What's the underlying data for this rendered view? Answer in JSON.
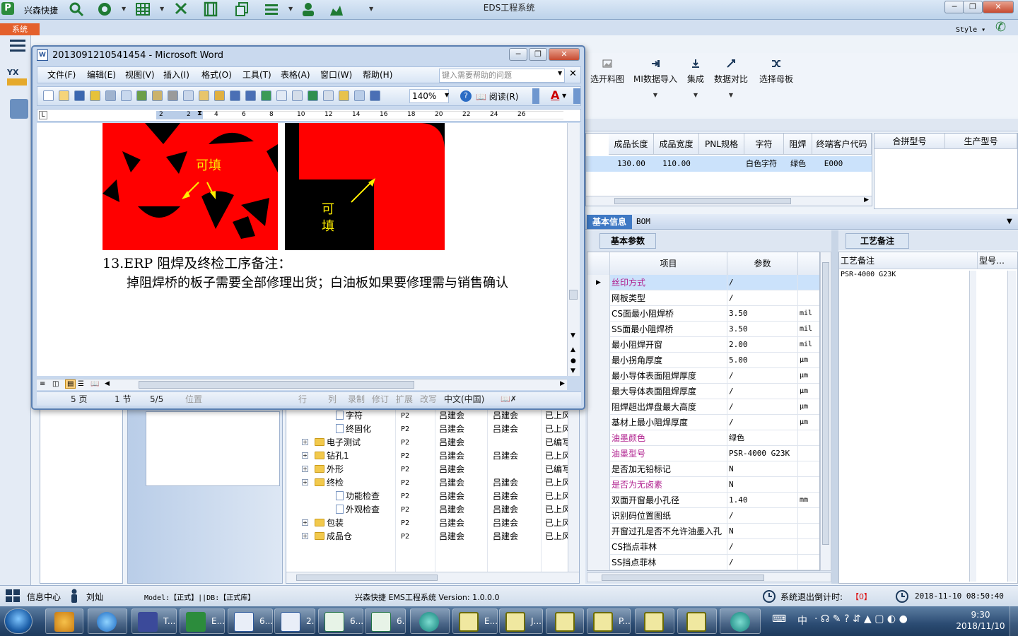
{
  "app": {
    "title": "EDS工程系统",
    "brand": "兴森快捷",
    "system_tab": "系统",
    "style_label": "Style"
  },
  "ribbon": {
    "buttons": [
      {
        "label": "选开料图"
      },
      {
        "label": "MI数据导入"
      },
      {
        "label": "集成"
      },
      {
        "label": "数据对比"
      },
      {
        "label": "选择母板"
      }
    ]
  },
  "product_grid": {
    "headers": [
      "成品长度",
      "成品宽度",
      "PNL规格",
      "字符",
      "阻焊",
      "终端客户代码"
    ],
    "row": [
      "130.00",
      "110.00",
      "",
      "白色字符",
      "绿色",
      "E000"
    ],
    "headers2": [
      "合拼型号",
      "生产型号"
    ]
  },
  "info": {
    "tabs": [
      "基本信息",
      "BOM"
    ],
    "subtab": "基本参数",
    "col_item": "项目",
    "col_param": "参数",
    "rows": [
      {
        "item": "丝印方式",
        "value": "/",
        "unit": "",
        "pink": true
      },
      {
        "item": "网板类型",
        "value": "/",
        "unit": "",
        "pink": false
      },
      {
        "item": "CS面最小阻焊桥",
        "value": "3.50",
        "unit": "mil",
        "pink": false
      },
      {
        "item": "SS面最小阻焊桥",
        "value": "3.50",
        "unit": "mil",
        "pink": false
      },
      {
        "item": "最小阻焊开窗",
        "value": "2.00",
        "unit": "mil",
        "pink": false
      },
      {
        "item": "最小拐角厚度",
        "value": "5.00",
        "unit": "μm",
        "pink": false
      },
      {
        "item": "最小导体表面阻焊厚度",
        "value": "/",
        "unit": "μm",
        "pink": false
      },
      {
        "item": "最大导体表面阻焊厚度",
        "value": "/",
        "unit": "μm",
        "pink": false
      },
      {
        "item": "阻焊超出焊盘最大高度",
        "value": "/",
        "unit": "μm",
        "pink": false
      },
      {
        "item": "基材上最小阻焊厚度",
        "value": "/",
        "unit": "μm",
        "pink": false
      },
      {
        "item": "油墨颜色",
        "value": "绿色",
        "unit": "",
        "pink": true
      },
      {
        "item": "油墨型号",
        "value": "PSR-4000 G23K",
        "unit": "",
        "pink": true
      },
      {
        "item": "是否加无铅标记",
        "value": "N",
        "unit": "",
        "pink": false
      },
      {
        "item": "是否为无卤素",
        "value": "N",
        "unit": "",
        "pink": true
      },
      {
        "item": "双面开窗最小孔径",
        "value": "1.40",
        "unit": "mm",
        "pink": false
      },
      {
        "item": "识别码位置图纸",
        "value": "/",
        "unit": "",
        "pink": false
      },
      {
        "item": "开窗过孔是否不允许油墨入孔",
        "value": "N",
        "unit": "",
        "pink": false
      },
      {
        "item": "CS挡点菲林",
        "value": "/",
        "unit": "",
        "pink": false
      },
      {
        "item": "SS挡点菲林",
        "value": "/",
        "unit": "",
        "pink": false
      }
    ]
  },
  "craft": {
    "tab": "工艺备注",
    "col1": "工艺备注",
    "col2": "型号…",
    "note": "PSR-4000 G23K"
  },
  "tree": {
    "rows": [
      {
        "name": "字符",
        "type": "doc",
        "indent": 1,
        "p": "P2",
        "a": "吕建会",
        "b": "吕建会",
        "s": "已上风"
      },
      {
        "name": "终固化",
        "type": "doc",
        "indent": 1,
        "p": "P2",
        "a": "吕建会",
        "b": "吕建会",
        "s": "已上风"
      },
      {
        "name": "电子测试",
        "type": "folder",
        "indent": 0,
        "p": "P2",
        "a": "吕建会",
        "b": "",
        "s": "已编写"
      },
      {
        "name": "钻孔1",
        "type": "folder",
        "indent": 0,
        "p": "P2",
        "a": "吕建会",
        "b": "吕建会",
        "s": "已上风"
      },
      {
        "name": "外形",
        "type": "folder",
        "indent": 0,
        "p": "P2",
        "a": "吕建会",
        "b": "",
        "s": "已编写"
      },
      {
        "name": "终检",
        "type": "folder",
        "indent": 0,
        "p": "P2",
        "a": "吕建会",
        "b": "吕建会",
        "s": "已上风"
      },
      {
        "name": "功能检查",
        "type": "doc",
        "indent": 1,
        "p": "P2",
        "a": "吕建会",
        "b": "吕建会",
        "s": "已上风"
      },
      {
        "name": "外观检查",
        "type": "doc",
        "indent": 1,
        "p": "P2",
        "a": "吕建会",
        "b": "吕建会",
        "s": "已上风"
      },
      {
        "name": "包装",
        "type": "folder",
        "indent": 0,
        "p": "P2",
        "a": "吕建会",
        "b": "吕建会",
        "s": "已上风"
      },
      {
        "name": "成品仓",
        "type": "folder",
        "indent": 0,
        "p": "P2",
        "a": "吕建会",
        "b": "吕建会",
        "s": "已上风"
      }
    ]
  },
  "word": {
    "title": "2013091210541454 - Microsoft Word",
    "menu": [
      "文件(F)",
      "编辑(E)",
      "视图(V)",
      "插入(I)",
      "格式(O)",
      "工具(T)",
      "表格(A)",
      "窗口(W)",
      "帮助(H)"
    ],
    "help_placeholder": "键入需要帮助的问题",
    "zoom": "140%",
    "read_btn": "阅读(R)",
    "img1_label": "可填",
    "img2_label": "可填",
    "heading": "13.ERP 阻焊及终检工序备注：",
    "body": "掉阻焊桥的板子需要全部修理出货；白油板如果要修理需与销售确认",
    "ruler_ticks": [
      "2",
      "2",
      "4",
      "6",
      "8",
      "10",
      "12",
      "14",
      "16",
      "18",
      "20",
      "22",
      "24",
      "26"
    ],
    "status": {
      "page": "5 页",
      "section": "1 节",
      "pages": "5/5",
      "position": "位置",
      "line": "行",
      "col": "列",
      "rec": "录制",
      "trk": "修订",
      "ext": "扩展",
      "ovr": "改写",
      "lang": "中文(中国)"
    }
  },
  "statusbar": {
    "info_center": "信息中心",
    "user": "刘灿",
    "model": "Model:【正式】||DB:【正式库】",
    "version": "兴森快捷 EMS工程系统 Version: 1.0.0.0",
    "countdown_label": "系统退出倒计时:",
    "countdown": "【0】",
    "datetime": "2018-11-10 08:50:40"
  },
  "taskbar": {
    "items": [
      "T...",
      "E...",
      "6...",
      "2...",
      "6...",
      "6...",
      "E...",
      "J...",
      "",
      "P...",
      "",
      ""
    ],
    "clock_time": "9:30",
    "clock_date": "2018/11/10",
    "ime": "中"
  }
}
